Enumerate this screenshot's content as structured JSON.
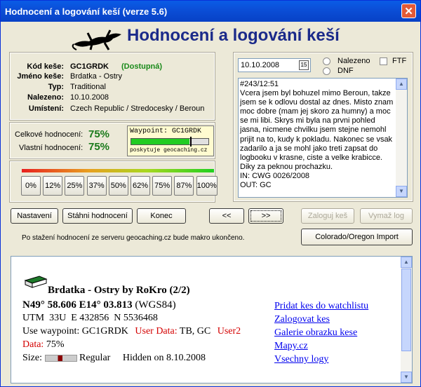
{
  "window": {
    "title": "Hodnocení a logování keší (verze 5.6)",
    "close_glyph": "✕"
  },
  "app_title": "Hodnocení a logování keší",
  "cache_info": {
    "code_label": "Kód keše:",
    "code_value": "GC1GRDK",
    "status": "(Dostupná)",
    "name_label": "Jméno keše:",
    "name_value": "Brdatka - Ostry",
    "type_label": "Typ:",
    "type_value": "Traditional",
    "found_label": "Nalezeno:",
    "found_value": "10.10.2008",
    "location_label": "Umístení:",
    "location_value": "Czech Republic / Stredocesky / Beroun"
  },
  "rating": {
    "overall_label": "Celkové hodnocení:",
    "overall_value": "75%",
    "own_label": "Vlastní hodnocení:",
    "own_value": "75%",
    "overall_fraction": 0.75
  },
  "waypoint_box": {
    "title": "Waypoint: GC1GRDK",
    "footer": "poskytuje geocaching.cz"
  },
  "rate_buttons": [
    "0%",
    "12%",
    "25%",
    "37%",
    "50%",
    "62%",
    "75%",
    "87%",
    "100%"
  ],
  "log": {
    "date_value": "10.10.2008",
    "found_label": "Nalezeno",
    "dnf_label": "DNF",
    "ftf_label": "FTF",
    "text": "#243/12:51\nVcera jsem byl bohuzel mimo Beroun, takze jsem se k odlovu dostal az dnes. Misto znam moc dobre (mam jej skoro za humny) a moc se mi libi. Skrys mi byla na prvni pohled jasna, nicmene chvilku jsem stejne nemohl prijit na to, kudy k pokladu. Nakonec se vsak zadarilo a ja se mohl jako treti zapsat do logbooku v krasne, ciste a velke krabicce. Diky za peknou prochazku.\nIN: CWG 0026/2008\nOUT: GC"
  },
  "buttons": {
    "settings": "Nastavení",
    "download": "Stáhni hodnocení",
    "end": "Konec",
    "prev": "<<",
    "next": ">>",
    "log_cache": "Zaloguj keš",
    "clear_log": "Vymaž log",
    "import": "Colorado/Oregon Import"
  },
  "note": "Po stažení hodnocení ze serveru geocaching.cz bude makro ukončeno.",
  "browser": {
    "heading": "Brdatka - Ostry by RoKro (2/2)",
    "coords": "N49° 58.606  E14° 03.813",
    "datum": "(WGS84)",
    "utm": "UTM  33U  E 432856  N 5536468",
    "use_wp_prefix": "Use waypoint: GC1GRDK",
    "user_data_label": "User Data:",
    "user_data_value": "TB, GC",
    "user2_label": "User2",
    "data_label": "Data:",
    "data_value": "75%",
    "size_label": "Size:",
    "size_value": "Regular",
    "hidden": "Hidden on 8.10.2008",
    "links": [
      "Pridat kes do watchlistu",
      "Zalogovat kes",
      "Galerie obrazku kese",
      "Mapy.cz",
      "Vsechny logy"
    ]
  },
  "colors": {
    "title_blue": "#1b2a8a",
    "rating_green": "#1a7a1a",
    "status_green": "#1a8a1a",
    "accent_red": "#d40000"
  }
}
